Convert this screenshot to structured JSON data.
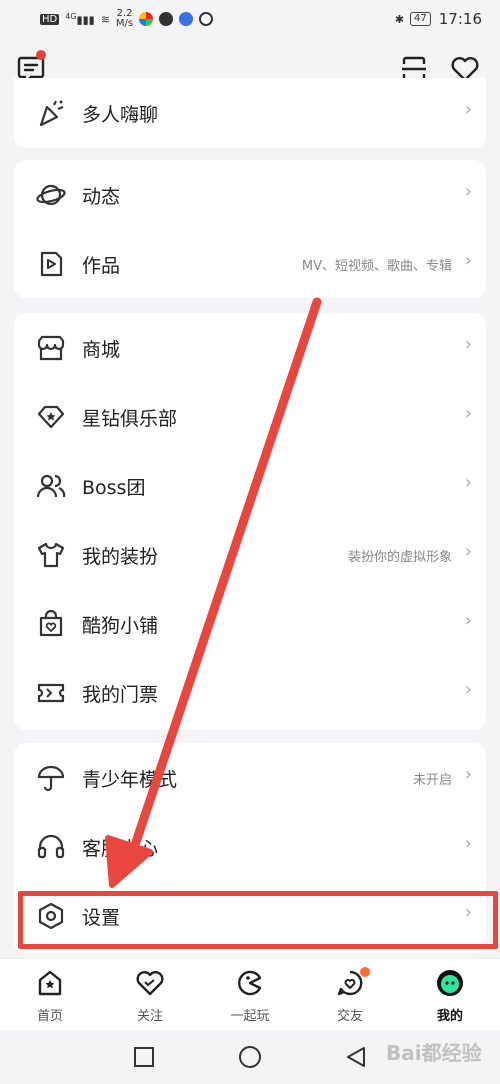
{
  "status_bar": {
    "network_label": "HD",
    "signal_label": "4G",
    "speed_value": "2.2",
    "speed_unit": "M/s",
    "battery_level": "47",
    "time": "17:16"
  },
  "sections": [
    {
      "items": [
        {
          "label": "多人嗨聊",
          "hint": "",
          "icon": "party-popper-icon"
        }
      ]
    },
    {
      "items": [
        {
          "label": "动态",
          "hint": "",
          "icon": "planet-icon"
        },
        {
          "label": "作品",
          "hint": "MV、短视频、歌曲、专辑",
          "icon": "play-document-icon"
        }
      ]
    },
    {
      "items": [
        {
          "label": "商城",
          "hint": "",
          "icon": "storefront-icon"
        },
        {
          "label": "星钻俱乐部",
          "hint": "",
          "icon": "diamond-star-icon"
        },
        {
          "label": "Boss团",
          "hint": "",
          "icon": "group-users-icon"
        },
        {
          "label": "我的装扮",
          "hint": "装扮你的虚拟形象",
          "icon": "shirt-icon"
        },
        {
          "label": "酷狗小铺",
          "hint": "",
          "icon": "shopping-bag-icon"
        },
        {
          "label": "我的门票",
          "hint": "",
          "icon": "ticket-icon"
        }
      ]
    },
    {
      "items": [
        {
          "label": "青少年模式",
          "hint": "未开启",
          "icon": "umbrella-icon"
        },
        {
          "label": "客服中心",
          "hint": "",
          "icon": "headset-icon"
        },
        {
          "label": "设置",
          "hint": "",
          "icon": "settings-hexagon-icon"
        }
      ]
    }
  ],
  "bottom_nav": [
    {
      "label": "首页",
      "icon": "home-icon"
    },
    {
      "label": "关注",
      "icon": "heart-icon"
    },
    {
      "label": "一起玩",
      "icon": "play-together-icon"
    },
    {
      "label": "交友",
      "icon": "friends-heart-icon"
    },
    {
      "label": "我的",
      "icon": "my-avatar-icon"
    }
  ],
  "watermark": "Bai都经验",
  "colors": {
    "accent_red": "#e8473f",
    "notification_dot": "#e7413a",
    "friends_badge": "#ff6b2c",
    "my_avatar": "#2ee6a0"
  }
}
